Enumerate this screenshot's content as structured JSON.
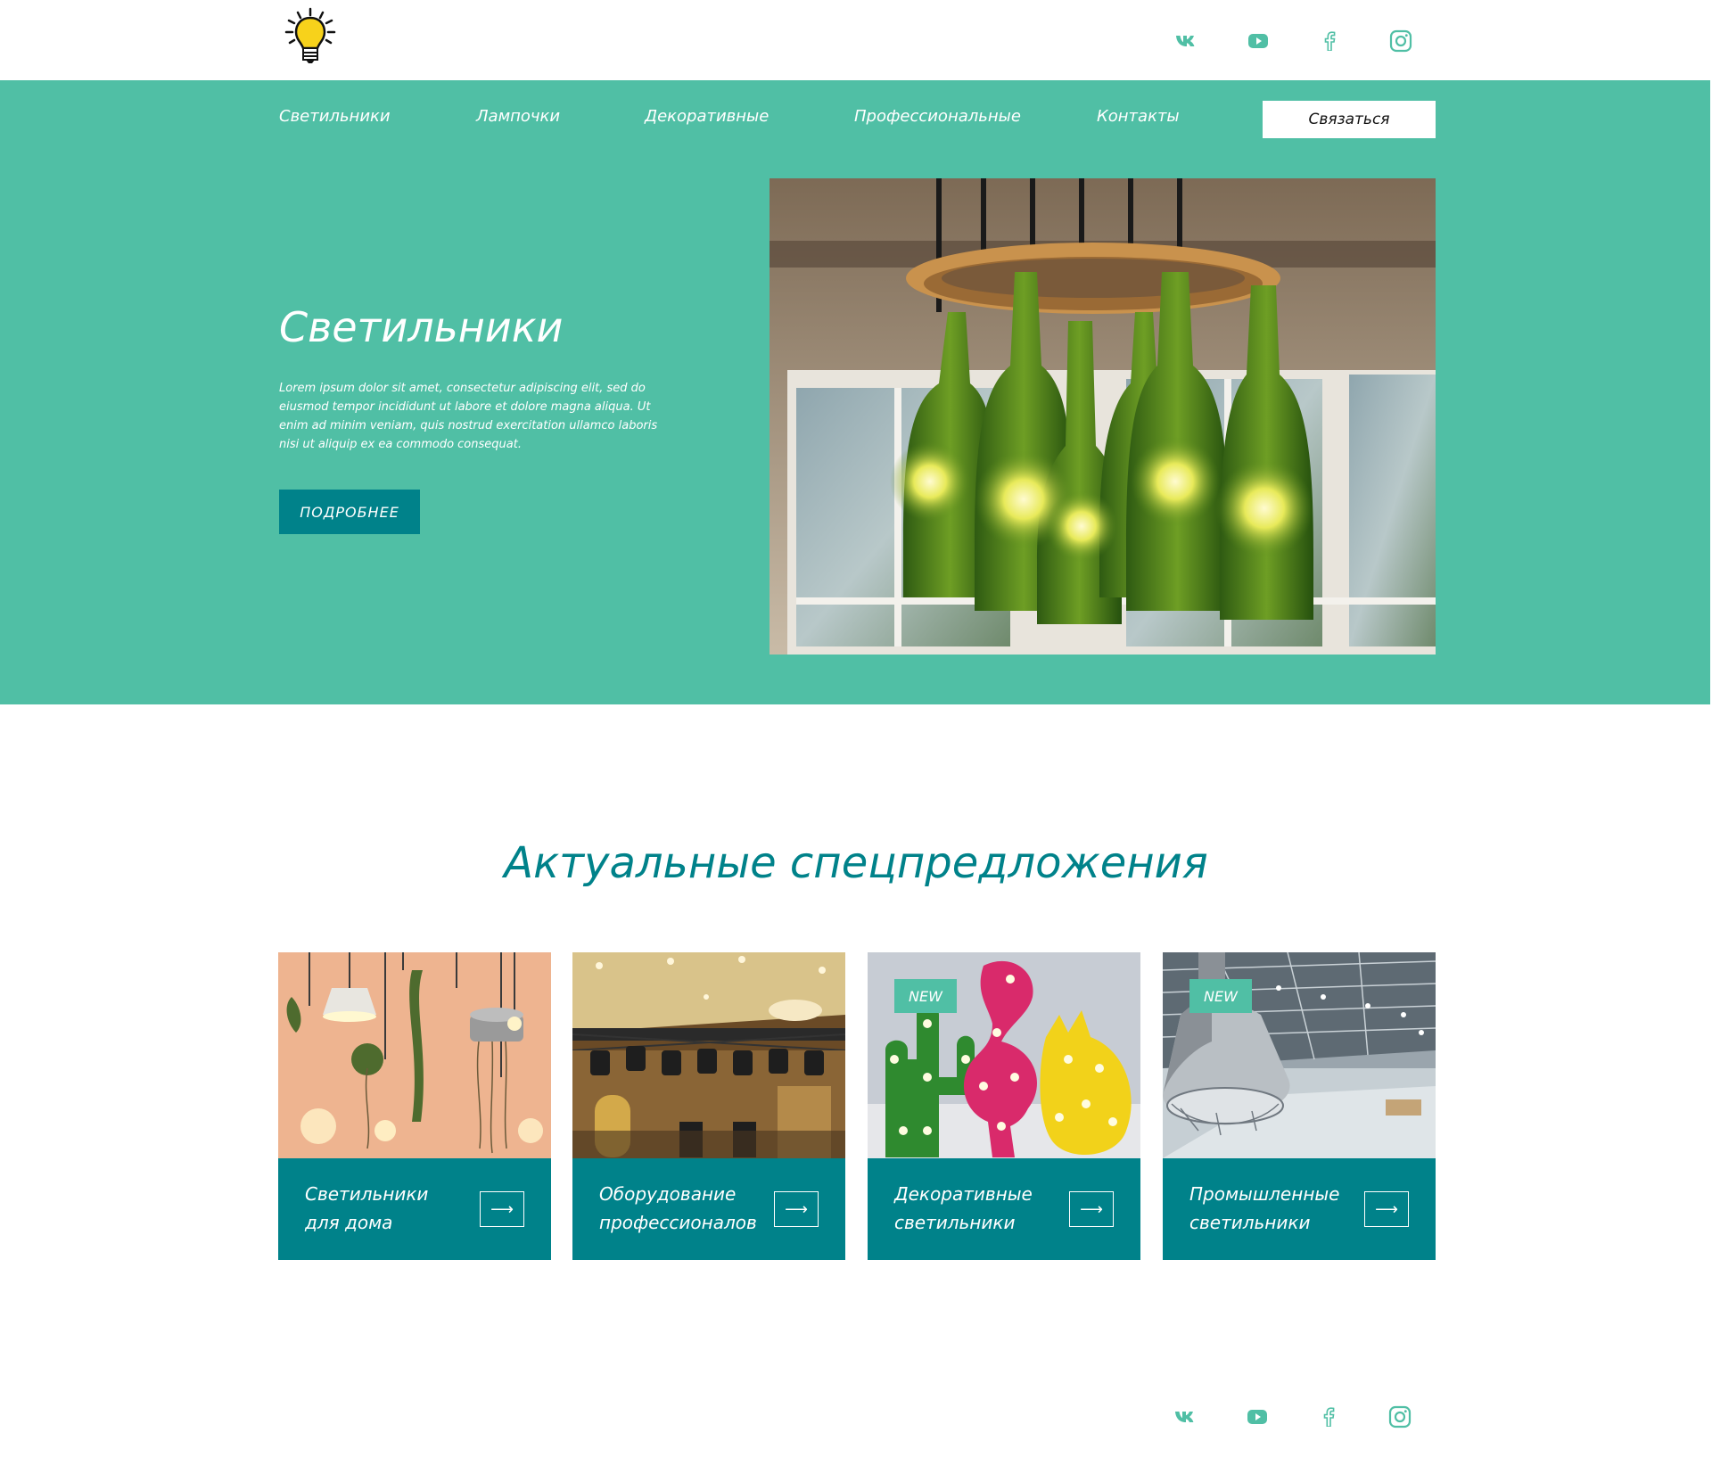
{
  "brand": {
    "logo_icon": "lightbulb-icon",
    "accent": "#50bfa5",
    "dark_accent": "#00828a"
  },
  "header": {
    "social": [
      {
        "icon": "vk-icon"
      },
      {
        "icon": "youtube-icon"
      },
      {
        "icon": "facebook-icon"
      },
      {
        "icon": "instagram-icon"
      }
    ]
  },
  "nav": {
    "items": [
      "Светильники",
      "Лампочки",
      "Декоративные",
      "Профессиональные",
      "Контакты"
    ],
    "contact_button": "Связаться"
  },
  "hero": {
    "title": "Светильники",
    "text": "Lorem ipsum dolor sit amet, consectetur adipiscing elit, sed do eiusmod tempor incididunt ut labore et dolore magna aliqua. Ut enim ad minim veniam, quis nostrud exercitation ullamco laboris nisi ut aliquip ex ea commodo consequat.",
    "button": "ПОДРОБНЕЕ"
  },
  "offers": {
    "title": "Актуальные спецпредложения",
    "cards": [
      {
        "title": "Светильники для дома",
        "badge": "",
        "arrow": "⟶"
      },
      {
        "title": "Оборудование профессионалов",
        "badge": "",
        "arrow": "⟶"
      },
      {
        "title": "Декоративные светильники",
        "badge": "NEW",
        "arrow": "⟶"
      },
      {
        "title": "Промышленные светильники",
        "badge": "NEW",
        "arrow": "⟶"
      }
    ]
  },
  "footer": {
    "social": [
      {
        "icon": "vk-icon"
      },
      {
        "icon": "youtube-icon"
      },
      {
        "icon": "facebook-icon"
      },
      {
        "icon": "instagram-icon"
      }
    ]
  }
}
